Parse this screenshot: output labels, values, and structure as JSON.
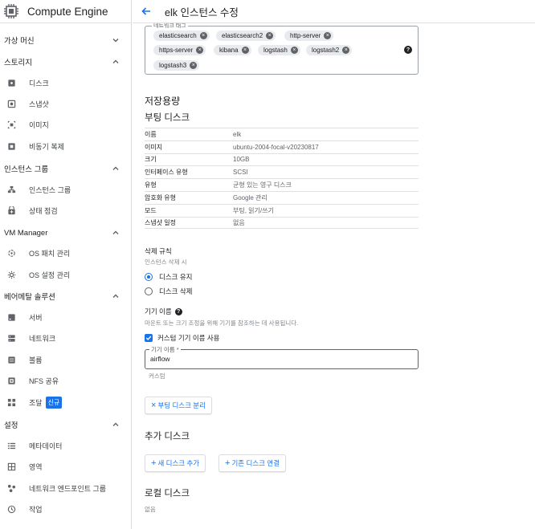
{
  "app": {
    "title": "Compute Engine"
  },
  "header": {
    "title": "elk 인스턴스 수정"
  },
  "sidebar": {
    "sections": [
      {
        "label": "가상 머신",
        "expanded": false,
        "items": []
      },
      {
        "label": "스토리지",
        "expanded": true,
        "items": [
          {
            "label": "디스크",
            "icon": "disk-icon"
          },
          {
            "label": "스냅샷",
            "icon": "snapshot-icon"
          },
          {
            "label": "이미지",
            "icon": "image-icon"
          },
          {
            "label": "비동기 복제",
            "icon": "async-replication-icon"
          }
        ]
      },
      {
        "label": "인스턴스 그룹",
        "expanded": true,
        "items": [
          {
            "label": "인스턴스 그룹",
            "icon": "instance-group-icon"
          },
          {
            "label": "상태 점검",
            "icon": "health-check-icon"
          }
        ]
      },
      {
        "label": "VM Manager",
        "expanded": true,
        "items": [
          {
            "label": "OS 패치 관리",
            "icon": "patch-icon"
          },
          {
            "label": "OS 설정 관리",
            "icon": "settings-icon"
          }
        ]
      },
      {
        "label": "베어메탈 솔루션",
        "expanded": true,
        "items": [
          {
            "label": "서버",
            "icon": "server-icon"
          },
          {
            "label": "네트워크",
            "icon": "network-icon"
          },
          {
            "label": "볼륨",
            "icon": "volume-icon"
          },
          {
            "label": "NFS 공유",
            "icon": "nfs-icon"
          },
          {
            "label": "조달",
            "icon": "procurement-icon",
            "badge": "신규"
          }
        ]
      },
      {
        "label": "설정",
        "expanded": true,
        "items": [
          {
            "label": "메타데이터",
            "icon": "metadata-icon"
          },
          {
            "label": "영역",
            "icon": "zones-icon"
          },
          {
            "label": "네트워크 엔드포인트 그룹",
            "icon": "neg-icon"
          },
          {
            "label": "작업",
            "icon": "operations-icon"
          }
        ]
      }
    ]
  },
  "network_tags": {
    "label": "네트워크 태그",
    "tags": [
      "elasticsearch",
      "elasticsearch2",
      "http-server",
      "https-server",
      "kibana",
      "logstash",
      "logstash2",
      "logstash3"
    ]
  },
  "storage": {
    "title": "저장용량",
    "boot_disk": {
      "title": "부팅 디스크",
      "rows": [
        {
          "key": "이름",
          "value": "elk"
        },
        {
          "key": "이미지",
          "value": "ubuntu-2004-focal-v20230817"
        },
        {
          "key": "크기",
          "value": "10GB"
        },
        {
          "key": "인터페이스 유형",
          "value": "SCSI"
        },
        {
          "key": "유형",
          "value": "균형 있는 영구 디스크"
        },
        {
          "key": "암호화 유형",
          "value": "Google 관리"
        },
        {
          "key": "모드",
          "value": "부팅, 읽기/쓰기"
        },
        {
          "key": "스냅샷 일정",
          "value": "없음"
        }
      ]
    },
    "deletion_rule": {
      "label": "삭제 규칙",
      "sub": "인스턴스 삭제 시",
      "options": [
        "디스크 유지",
        "디스크 삭제"
      ],
      "selected": 0
    },
    "device_name": {
      "label": "기기 이름",
      "sub": "마운트 또는 크기 조정을 위해 기기를 참조하는 데 사용됩니다.",
      "checkbox_label": "커스텀 기기 이름 사용",
      "checked": true,
      "field_label": "기기 이름 *",
      "value": "airflow",
      "helper": "커스텀"
    },
    "detach_button": "부팅 디스크 분리",
    "additional_disks": {
      "title": "추가 디스크",
      "add_new": "새 디스크 추가",
      "attach_existing": "기존 디스크 연결"
    },
    "local_disks": {
      "title": "로컬 디스크",
      "value": "없음"
    }
  }
}
